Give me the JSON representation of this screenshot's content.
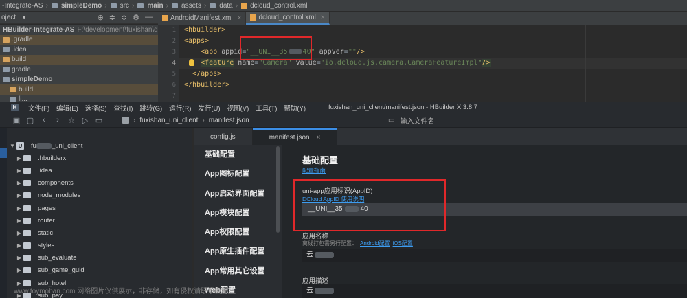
{
  "android_studio": {
    "breadcrumb": [
      "-Integrate-AS",
      "simpleDemo",
      "src",
      "main",
      "assets",
      "data",
      "dcloud_control.xml"
    ],
    "project_label": "oject",
    "tabs": [
      {
        "label": "AndroidManifest.xml",
        "active": false
      },
      {
        "label": "dcloud_control.xml",
        "active": true
      }
    ],
    "tree": [
      {
        "label": "HBuilder-Integrate-AS",
        "path": "F:\\development\\fuxishan\\deve",
        "bold": true,
        "highlight": false
      },
      {
        "label": ".gradle",
        "highlight": true
      },
      {
        "label": ".idea",
        "highlight": false
      },
      {
        "label": "build",
        "highlight": true
      },
      {
        "label": "gradle",
        "highlight": false
      },
      {
        "label": "simpleDemo",
        "bold": true,
        "highlight": false
      },
      {
        "label": "build",
        "highlight": true
      },
      {
        "label": "li...",
        "highlight": false
      }
    ],
    "line_numbers": [
      "1",
      "2",
      "3",
      "4",
      "5",
      "6",
      "7"
    ],
    "code": {
      "line1": "<hbuilder>",
      "line2": "<apps>",
      "app_open": "<app ",
      "appid_attr": "appid",
      "appid_value": "\"__UNI__35",
      "appid_value_end": "40\"",
      "appver_attr": " appver",
      "appver_value": "\"\"",
      "app_close": "/>",
      "feature_open": "<feature",
      "name_attr": " name",
      "name_value": "\"Camera\"",
      "value_attr": " value",
      "value_value": "\"io.dcloud.js.camera.CameraFeatureImpl\"",
      "feature_close": "/>",
      "line5": "</apps>",
      "line6": "</hbuilder>"
    }
  },
  "hbuilder": {
    "menu": [
      "文件(F)",
      "编辑(E)",
      "选择(S)",
      "查找(I)",
      "跳转(G)",
      "运行(R)",
      "发行(U)",
      "视图(V)",
      "工具(T)",
      "帮助(Y)"
    ],
    "title": "fuxishan_uni_client/manifest.json - HBuilder X 3.8.7",
    "toolbar_breadcrumb": [
      "fuxishan_uni_client",
      "manifest.json"
    ],
    "search_placeholder": "输入文件名",
    "file_tree": {
      "project_prefix": "fu",
      "project_suffix": "_uni_client",
      "folders": [
        ".hbuilderx",
        ".idea",
        "components",
        "node_modules",
        "pages",
        "router",
        "static",
        "styles",
        "sub_evaluate",
        "sub_game_guid",
        "sub_hotel",
        "sub_pay"
      ]
    },
    "editor_tabs": [
      {
        "label": "config.js",
        "active": false
      },
      {
        "label": "manifest.json",
        "active": true
      }
    ],
    "nav": [
      "基础配置",
      "App图标配置",
      "App启动界面配置",
      "App模块配置",
      "App权限配置",
      "App原生插件配置",
      "App常用其它设置",
      "Web配置"
    ],
    "form": {
      "title": "基础配置",
      "guide_link": "配置指南",
      "appid_label": "uni-app应用标识(AppID)",
      "appid_help": "DCloud AppID 使用说明",
      "appid_value_start": "__UNI__35",
      "appid_value_end": "40",
      "name_label": "应用名称",
      "name_sub": "离线打包需另行配置：",
      "name_sub_android": "Android配置",
      "name_sub_ios": "iOS配置",
      "name_value": "云",
      "desc_label": "应用描述",
      "desc_value": "云"
    }
  },
  "watermark": "www.toymoban.com 网络图片仅供展示，非存储，如有侵权请联系删除。",
  "colors": {
    "highlight_box": "#e0282a",
    "link": "#3d9cf0",
    "xml_tag": "#e8bf6a",
    "xml_string": "#6a8759"
  }
}
